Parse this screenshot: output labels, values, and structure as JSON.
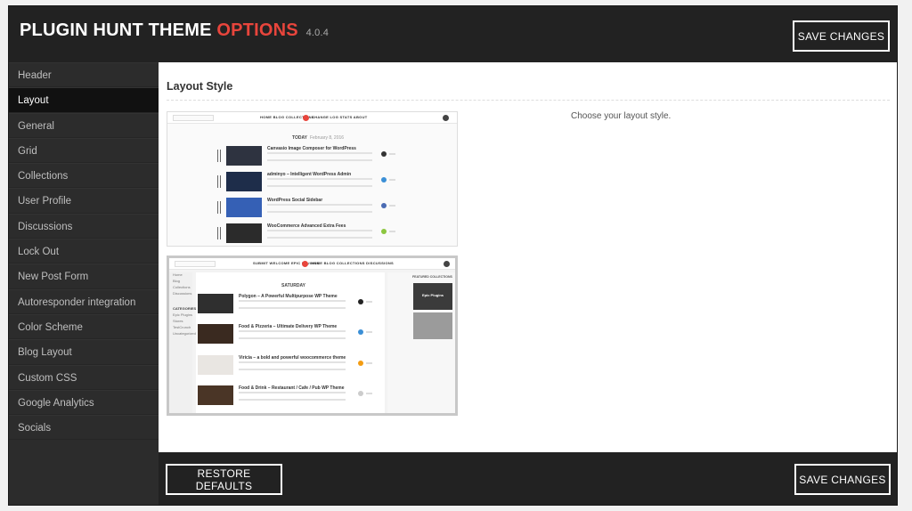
{
  "header": {
    "title_main": "PLUGIN HUNT THEME",
    "title_accent": "OPTIONS",
    "version": "4.0.4",
    "save_label": "SAVE CHANGES"
  },
  "sidebar": {
    "items": [
      {
        "label": "Header"
      },
      {
        "label": "Layout",
        "active": true
      },
      {
        "label": "General"
      },
      {
        "label": "Grid"
      },
      {
        "label": "Collections"
      },
      {
        "label": "User Profile"
      },
      {
        "label": "Discussions"
      },
      {
        "label": "Lock Out"
      },
      {
        "label": "New Post Form"
      },
      {
        "label": "Autoresponder integration"
      },
      {
        "label": "Color Scheme"
      },
      {
        "label": "Blog Layout"
      },
      {
        "label": "Custom CSS"
      },
      {
        "label": "Google Analytics"
      },
      {
        "label": "Socials"
      }
    ]
  },
  "main": {
    "section_title": "Layout Style",
    "description": "Choose your layout style.",
    "layout_options": [
      {
        "menu": "HOME BLOG COLLECTIONS",
        "menu2": "CHANGE LOG STATS ABOUT",
        "day": "TODAY",
        "date": "February 8, 2016",
        "posts": [
          {
            "title": "Canvasio Image Composer for WordPress"
          },
          {
            "title": "adminyo – Intelligent WordPress Admin"
          },
          {
            "title": "WordPress Social Sidebar"
          },
          {
            "title": "WooCommerce Advanced Extra Fees"
          }
        ]
      },
      {
        "menu": "SUBMIT WELCOME EPIC PLUGINS",
        "menu2": "HOME BLOG COLLECTIONS DISCUSSIONS",
        "day": "SATURDAY",
        "date": "",
        "side_links": [
          "Home",
          "Blog",
          "Collections",
          "Discussions"
        ],
        "categories_label": "CATEGORIES",
        "categories": [
          "Epic Plugins",
          "Stores",
          "TestCrunch",
          "Uncategorized"
        ],
        "featured_label": "FEATURED COLLECTIONS",
        "featured_item": "Epic Plugins",
        "posts": [
          {
            "title": "Polygon – A Powerful Multipurpose WP Theme"
          },
          {
            "title": "Food & Pizzeria – Ultimate Delivery WP Theme"
          },
          {
            "title": "Viricia – a bold and powerful woocommerce theme"
          },
          {
            "title": "Food & Drink – Restaurant / Cafe / Pub WP Theme"
          }
        ]
      }
    ]
  },
  "footer": {
    "restore_label": "RESTORE DEFAULTS",
    "save_label": "SAVE CHANGES"
  },
  "colors": {
    "accent": "#e8453c",
    "dark_bg": "#222222",
    "sidebar_bg": "#2c2c2c",
    "sidebar_active_bg": "#111111"
  }
}
